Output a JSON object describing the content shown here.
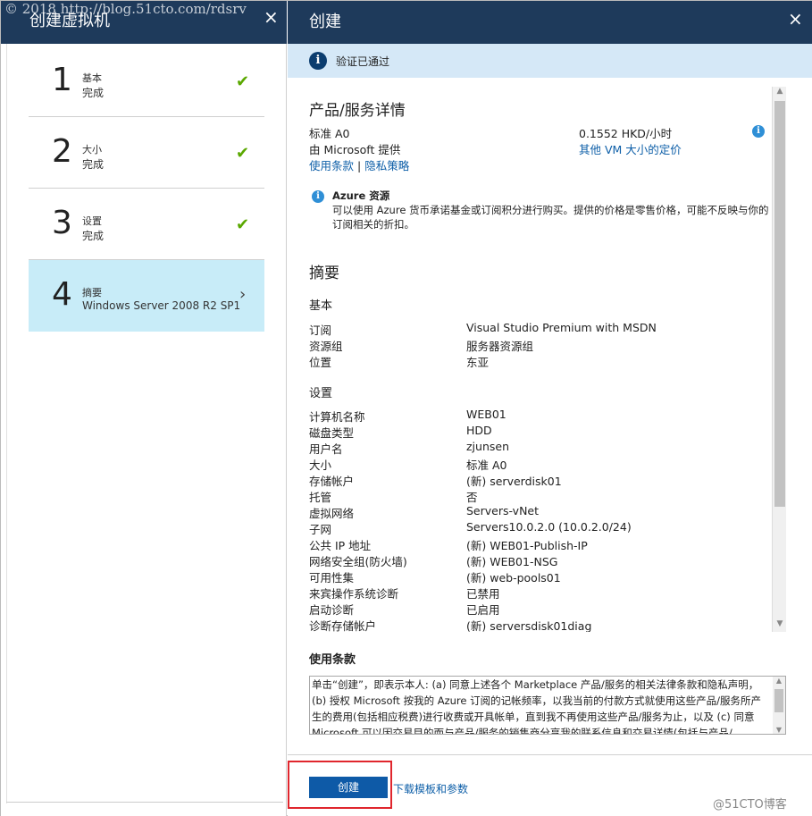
{
  "watermark": "© 2018 http://blog.51cto.com/rdsrv",
  "left_blade": {
    "title": "创建虚拟机",
    "close": "×",
    "steps": [
      {
        "num": "1",
        "label": "基本",
        "sub": "完成",
        "check": "✔"
      },
      {
        "num": "2",
        "label": "大小",
        "sub": "完成",
        "check": "✔"
      },
      {
        "num": "3",
        "label": "设置",
        "sub": "完成",
        "check": "✔"
      },
      {
        "num": "4",
        "label": "摘要",
        "sub": "Windows Server 2008 R2 SP1",
        "chevron": "›"
      }
    ]
  },
  "right_blade": {
    "title": "创建",
    "close": "×",
    "validation": {
      "icon": "i",
      "text": "验证已通过"
    },
    "product": {
      "heading": "产品/服务详情",
      "name": "标准 A0",
      "provider": "由 Microsoft 提供",
      "terms_link": "使用条款",
      "separator": "|",
      "privacy_link": "隐私策略",
      "price": "0.1552 HKD/小时",
      "pricing_link": "其他 VM 大小的定价",
      "info_icon": "i"
    },
    "azure_note": {
      "title": "Azure 资源",
      "text": "可以使用 Azure 货币承诺基金或订阅积分进行购买。提供的价格是零售价格，可能不反映与你的订阅相关的折扣。"
    },
    "summary": {
      "heading": "摘要",
      "basics_heading": "基本",
      "basics": [
        {
          "key": "订阅",
          "value": "Visual Studio Premium with MSDN"
        },
        {
          "key": "资源组",
          "value": "服务器资源组"
        },
        {
          "key": "位置",
          "value": "东亚"
        }
      ],
      "settings_heading": "设置",
      "settings": [
        {
          "key": "计算机名称",
          "value": "WEB01"
        },
        {
          "key": "磁盘类型",
          "value": "HDD"
        },
        {
          "key": "用户名",
          "value": "zjunsen"
        },
        {
          "key": "大小",
          "value": "标准 A0"
        },
        {
          "key": "存储帐户",
          "value": "(新) serverdisk01"
        },
        {
          "key": "托管",
          "value": "否"
        },
        {
          "key": "虚拟网络",
          "value": "Servers-vNet"
        },
        {
          "key": "子网",
          "value": "Servers10.0.2.0 (10.0.2.0/24)"
        },
        {
          "key": "公共 IP 地址",
          "value": "(新) WEB01-Publish-IP"
        },
        {
          "key": "网络安全组(防火墙)",
          "value": "(新) WEB01-NSG"
        },
        {
          "key": "可用性集",
          "value": "(新) web-pools01"
        },
        {
          "key": "来宾操作系统诊断",
          "value": "已禁用"
        },
        {
          "key": "启动诊断",
          "value": "已启用"
        },
        {
          "key": "诊断存储帐户",
          "value": "(新) serversdisk01diag"
        }
      ]
    },
    "terms": {
      "heading": "使用条款",
      "text": "单击“创建”，即表示本人: (a) 同意上述各个 Marketplace 产品/服务的相关法律条款和隐私声明，(b) 授权 Microsoft 按我的 Azure 订阅的记帐频率，以我当前的付款方式就使用这些产品/服务所产生的费用(包括相应税费)进行收费或开具帐单，直到我不再使用这些产品/服务为止，以及 (c) 同意 Microsoft 可以因交易目的而与产品/服务的销售商分享我的联系信息和交易详情(包括与产品/"
    },
    "footer": {
      "create_button": "创建",
      "download_link": "下载模板和参数",
      "brand": "@51CTO博客"
    }
  }
}
